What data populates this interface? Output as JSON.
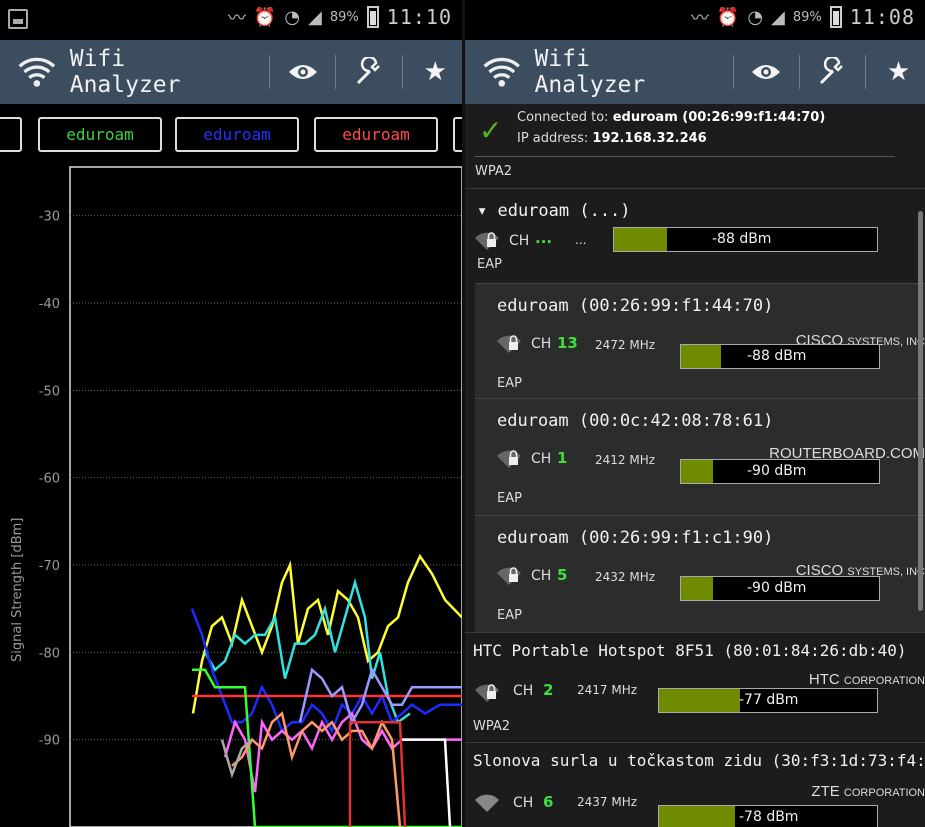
{
  "left": {
    "status": {
      "battery": "89%",
      "time": "11:10"
    },
    "app_title": "Wifi Analyzer",
    "tabs": [
      {
        "label": "eduroam",
        "color": "#3bd13b"
      },
      {
        "label": "eduroam",
        "color": "#2233ff"
      },
      {
        "label": "eduroam",
        "color": "#ff4a4a"
      }
    ],
    "chart": {
      "yaxis_title": "Signal Strength [dBm]",
      "ticks": [
        "-30",
        "-40",
        "-50",
        "-60",
        "-70",
        "-80",
        "-90"
      ]
    }
  },
  "right": {
    "status": {
      "battery": "89%",
      "time": "11:08"
    },
    "app_title": "Wifi Analyzer",
    "connected": {
      "prefix": "Connected to: ",
      "ssid": "eduroam (00:26:99:f1:44:70)",
      "ip_prefix": "IP address: ",
      "ip": "192.168.32.246"
    },
    "top_security": "WPA2",
    "group": {
      "title": "▾ eduroam (...)",
      "ch_label": "CH",
      "ch": "...",
      "freq": "...",
      "signal": "-88 dBm",
      "fill": 0.2,
      "security": "EAP"
    },
    "networks": [
      {
        "title": "eduroam (00:26:99:f1:44:70)",
        "vendor": "CISCO",
        "vendor_small": "SYSTEMS, INC",
        "ch_label": "CH",
        "ch": "13",
        "freq": "2472 MHz",
        "signal": "-88 dBm",
        "fill": 0.2,
        "security": "EAP"
      },
      {
        "title": "eduroam (00:0c:42:08:78:61)",
        "vendor": "ROUTERBOARD.COM",
        "vendor_small": "",
        "ch_label": "CH",
        "ch": "1",
        "freq": "2412 MHz",
        "signal": "-90 dBm",
        "fill": 0.16,
        "security": "EAP"
      },
      {
        "title": "eduroam (00:26:99:f1:c1:90)",
        "vendor": "CISCO",
        "vendor_small": "SYSTEMS, INC",
        "ch_label": "CH",
        "ch": "5",
        "freq": "2432 MHz",
        "signal": "-90 dBm",
        "fill": 0.16,
        "security": "EAP"
      },
      {
        "title": "HTC Portable Hotspot 8F51 (80:01:84:26:db:40)",
        "vendor": "HTC",
        "vendor_small": "CORPORATION",
        "ch_label": "CH",
        "ch": "2",
        "freq": "2417 MHz",
        "signal": "-77 dBm",
        "fill": 0.37,
        "security": "WPA2"
      },
      {
        "title": "Slonova surla u točkastom zidu (30:f3:1d:73:f4:…",
        "vendor": "ZTE",
        "vendor_small": "CORPORATION",
        "ch_label": "CH",
        "ch": "6",
        "freq": "2437 MHz",
        "signal": "-78 dBm",
        "fill": 0.35,
        "security": ""
      }
    ]
  }
}
